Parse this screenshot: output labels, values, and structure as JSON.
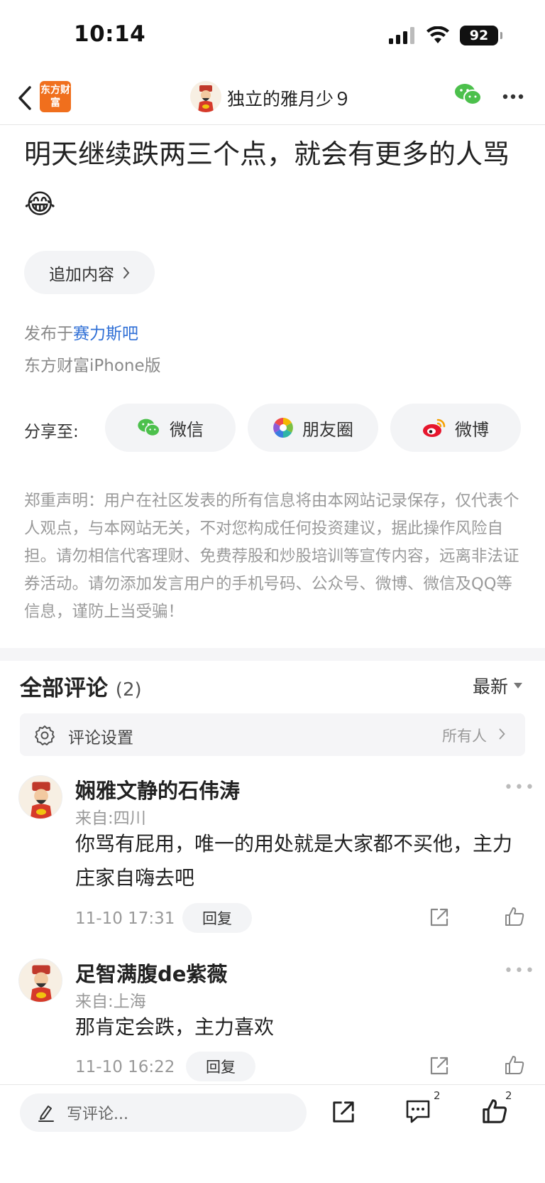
{
  "status_bar": {
    "time": "10:14",
    "battery": "92"
  },
  "nav": {
    "logo_text": "东方财富",
    "title": "独立的雅月少９"
  },
  "post": {
    "text": "明天继续跌两三个点，就会有更多的人骂😂",
    "append_label": "追加内容",
    "published_prefix": "发布于",
    "forum_link": "赛力斯吧",
    "client": "东方财富iPhone版"
  },
  "share": {
    "label": "分享至:",
    "wechat": "微信",
    "moments": "朋友圈",
    "weibo": "微博"
  },
  "disclaimer": "郑重声明：用户在社区发表的所有信息将由本网站记录保存，仅代表个人观点，与本网站无关，不对您构成任何投资建议，据此操作风险自担。请勿相信代客理财、免费荐股和炒股培训等宣传内容，远离非法证券活动。请勿添加发言用户的手机号码、公众号、微博、微信及QQ等信息，谨防上当受骗！",
  "comments_section": {
    "title": "全部评论",
    "count": "(2)",
    "sort": "最新",
    "settings_label": "评论设置",
    "settings_value": "所有人"
  },
  "comments": [
    {
      "name": "娴雅文静的石伟涛",
      "location": "来自:四川",
      "text": "你骂有屁用，唯一的用处就是大家都不买他，主力庄家自嗨去吧",
      "time": "11-10 17:31",
      "reply_label": "回复"
    },
    {
      "name": "足智满腹de紫薇",
      "location": "来自:上海",
      "text": "那肯定会跌，主力喜欢",
      "time": "11-10 16:22",
      "reply_label": "回复"
    }
  ],
  "bottom_bar": {
    "write_placeholder": "写评论...",
    "comment_count": "2",
    "like_count": "2"
  },
  "colors": {
    "brand_orange": "#f06f1d",
    "link_blue": "#2f6fd6",
    "wechat_green": "#4cc04c",
    "weibo_red": "#e6162d"
  }
}
